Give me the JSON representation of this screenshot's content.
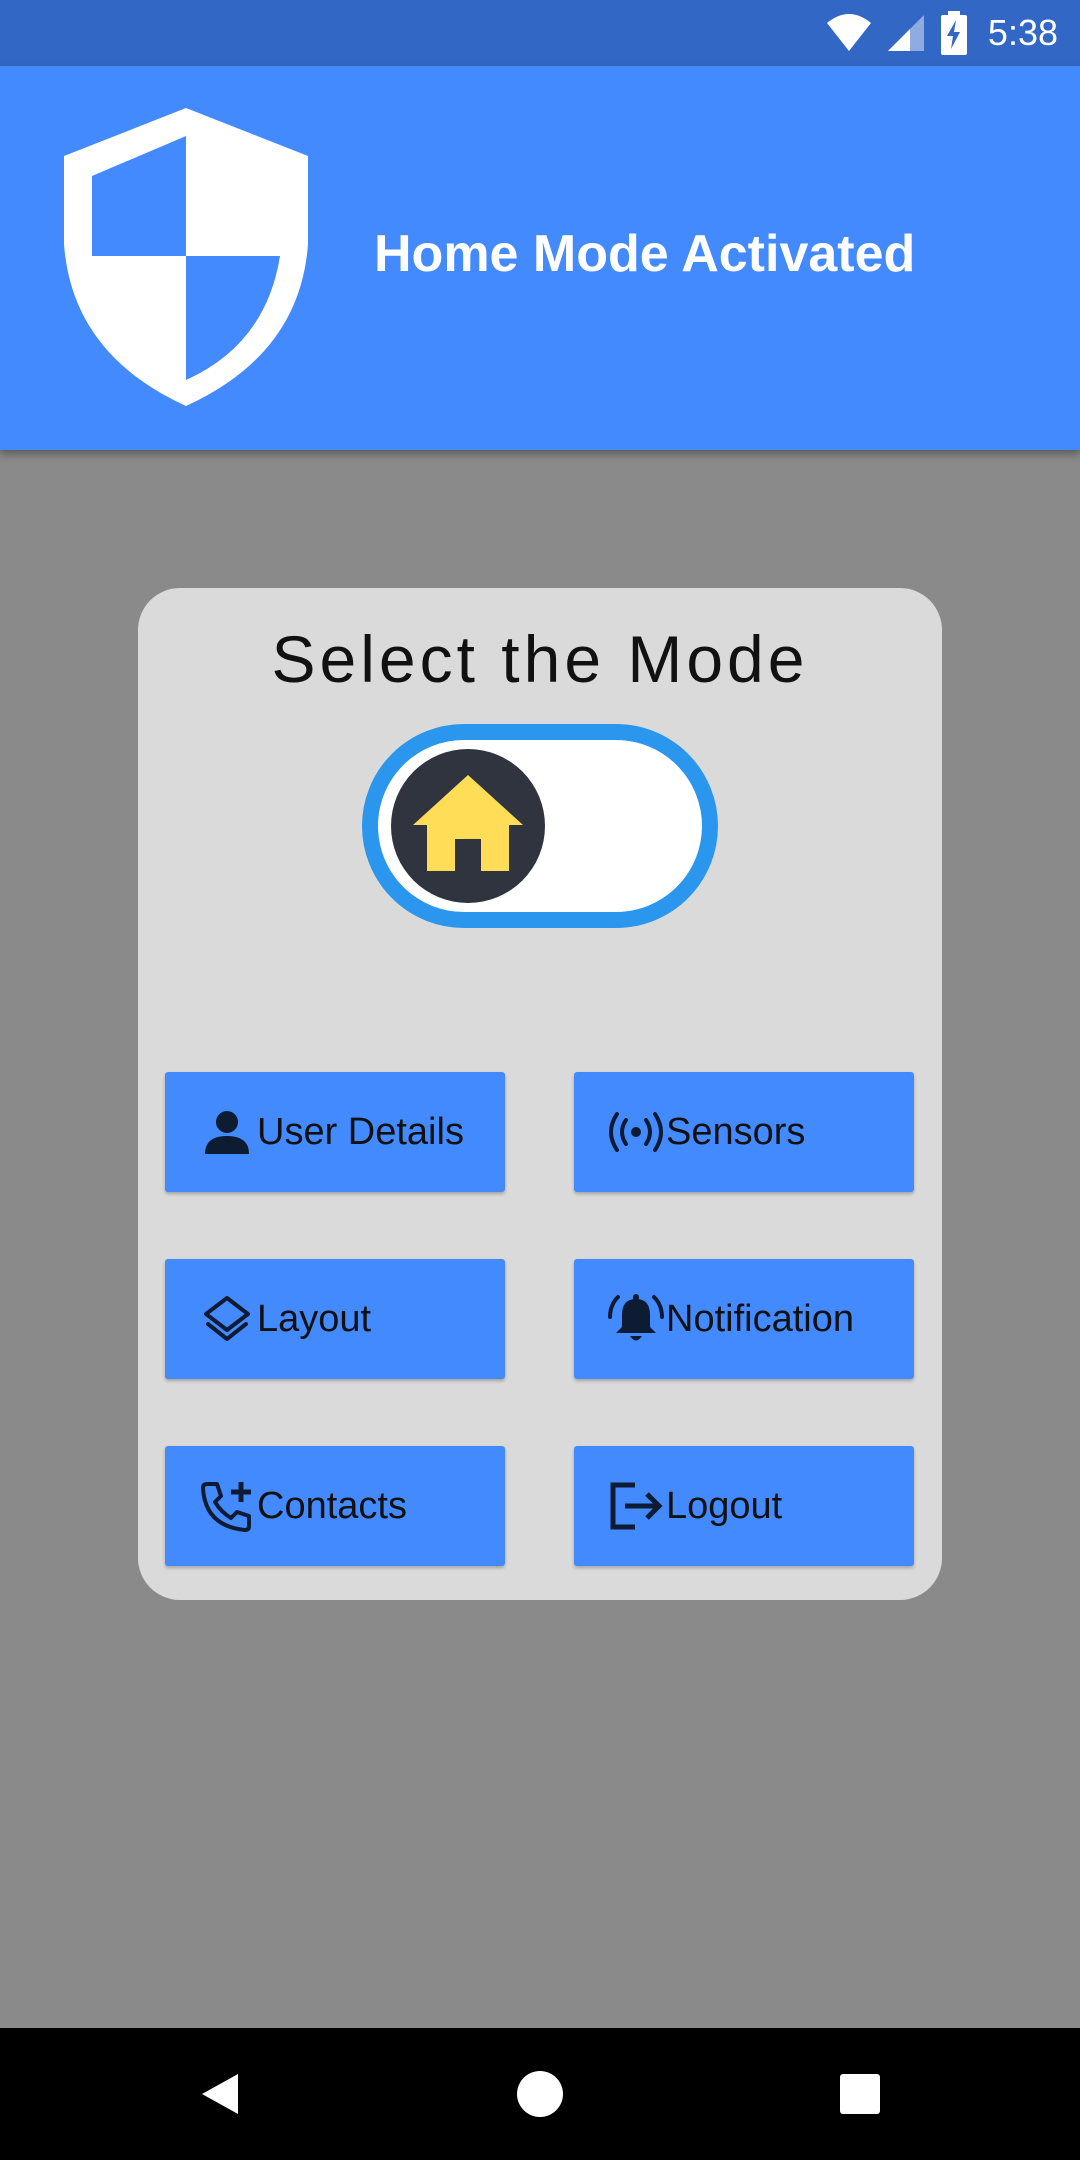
{
  "status_bar": {
    "time": "5:38",
    "icons": [
      "wifi-icon",
      "cell-signal-icon",
      "battery-charging-icon"
    ]
  },
  "app_bar": {
    "title": "Home Mode Activated",
    "logo_icon": "shield-icon"
  },
  "mode_card": {
    "title": "Select the Mode",
    "toggle": {
      "current_mode": "home",
      "knob_icon": "home-icon"
    }
  },
  "menu": {
    "buttons": [
      {
        "label": "User Details",
        "icon": "person-icon"
      },
      {
        "label": "Sensors",
        "icon": "sensors-icon"
      },
      {
        "label": "Layout",
        "icon": "layers-icon"
      },
      {
        "label": "Notification",
        "icon": "bell-ringing-icon"
      },
      {
        "label": "Contacts",
        "icon": "phone-add-icon"
      },
      {
        "label": "Logout",
        "icon": "logout-icon"
      }
    ]
  },
  "nav_bar": {
    "buttons": [
      "back-icon",
      "home-circle-icon",
      "recents-square-icon"
    ]
  },
  "colors": {
    "status_bar": "#3367c6",
    "app_bar": "#448aff",
    "background": "#8a8a8a",
    "card": "#dadada",
    "toggle_border": "#2a96ee",
    "knob": "#2f343f",
    "home_icon": "#ffdd57",
    "button": "#448aff"
  }
}
